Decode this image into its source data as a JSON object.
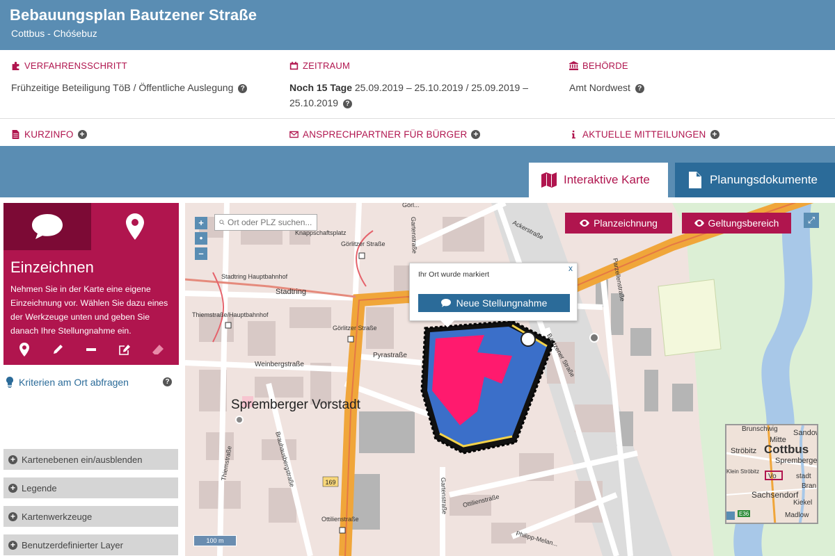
{
  "header": {
    "title": "Bebauungsplan Bautzener Straße",
    "subtitle": "Cottbus - Chóśebuz"
  },
  "info": {
    "step": {
      "label": "VERFAHRENSSCHRITT",
      "value": "Frühzeitige Beteiligung TöB / Öffentliche Auslegung"
    },
    "period": {
      "label": "ZEITRAUM",
      "value_bold": "Noch 15 Tage",
      "value_line1": "25.09.2019 – 25.10.2019 / 25.09.2019 –",
      "value_line2": "25.10.2019"
    },
    "authority": {
      "label": "BEHÖRDE",
      "value": "Amt Nordwest"
    }
  },
  "subnav": {
    "kurzinfo": "KURZINFO",
    "contact": "ANSPRECHPARTNER FÜR BÜRGER",
    "news": "AKTUELLE MITTEILUNGEN"
  },
  "tabs": {
    "map": "Interaktive Karte",
    "docs": "Planungsdokumente"
  },
  "panel": {
    "heading": "Einzeichnen",
    "text": "Nehmen Sie in der Karte eine eigene Einzeichnung vor. Wählen Sie dazu eines der Werkzeuge unten und geben Sie danach Ihre Stellungnahme ein.",
    "criteria": "Kriterien am Ort abfragen",
    "accordion": [
      "Kartenebenen ein/ausblenden",
      "Legende",
      "Kartenwerkzeuge",
      "Benutzerdefinierter Layer"
    ]
  },
  "map": {
    "search_placeholder": "Ort oder PLZ suchen...",
    "btn_plan": "Planzeichnung",
    "btn_scope": "Geltungsbereich",
    "popup_msg": "Ihr Ort wurde markiert",
    "popup_btn": "Neue Stellungnahme",
    "popup_close": "x",
    "scale": "100 m",
    "labels": {
      "district": "Spremberger Vorstadt",
      "knappschaftsplatz": "Knappschaftsplatz",
      "goerlitzer1": "Görlitzer Straße",
      "goerlitzer2": "Görlitzer Straße",
      "stadtring_hbf": "Stadtring Hauptbahnhof",
      "stadtring": "Stadtring",
      "thiemstr_hbf": "Thiemstraße/Hauptbahnhof",
      "weinberg": "Weinbergstraße",
      "pyrastr": "Pyrastraße",
      "ackerstr": "Ackerstraße",
      "parzellen": "Parzellenstraße",
      "bautzener": "Bautzener Straße",
      "thiemstr": "Thiemstraße",
      "brauhaus": "Brauhausbergstraße",
      "gartenstr": "Gartenstraße",
      "gartenstr2": "Gartenstraße",
      "ottilien": "Ottilienstraße",
      "ottilien2": "Ottilienstraße",
      "philipp": "Philipp-Melan...",
      "goerl_top": "Görl...",
      "road169": "169"
    },
    "overview": {
      "city": "Cottbus",
      "labels": [
        "Brunschwig",
        "Sandow",
        "Mitte",
        "Ströbitz",
        "Spremberger",
        "Klein Ströbitz",
        "Vo",
        "stadt",
        "Bran",
        "Sachsendorf",
        "Kiekel",
        "Madlow",
        "E36"
      ]
    },
    "colors": {
      "accent": "#b0154e",
      "blue": "#2b6b99",
      "road_major": "#f0a63a",
      "plan_pink": "#ff1a6e"
    }
  }
}
